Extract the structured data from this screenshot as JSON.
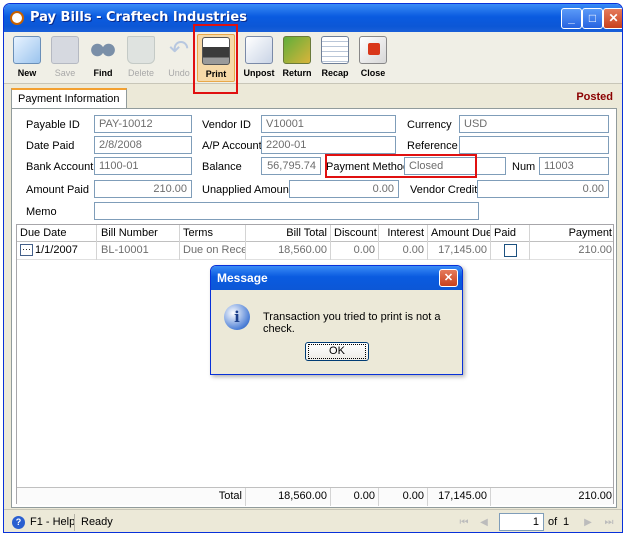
{
  "window": {
    "title": "Pay Bills - Craftech Industries"
  },
  "toolbar": [
    {
      "label": "New",
      "icon": "new-record-icon",
      "enabled": true
    },
    {
      "label": "Save",
      "icon": "save-disk-icon",
      "enabled": false
    },
    {
      "label": "Find",
      "icon": "binoculars-icon",
      "enabled": true
    },
    {
      "label": "Delete",
      "icon": "recycle-bin-icon",
      "enabled": false
    },
    {
      "label": "Undo",
      "icon": "undo-arrow-icon",
      "enabled": false
    },
    {
      "label": "Print",
      "icon": "printer-icon",
      "enabled": true
    },
    {
      "label": "Unpost",
      "icon": "unpost-icon",
      "enabled": true
    },
    {
      "label": "Return",
      "icon": "return-money-icon",
      "enabled": true
    },
    {
      "label": "Recap",
      "icon": "recap-sheet-icon",
      "enabled": true
    },
    {
      "label": "Close",
      "icon": "close-door-icon",
      "enabled": true
    }
  ],
  "tab": {
    "label": "Payment Information"
  },
  "status_badge": "Posted",
  "form": {
    "payable_id": {
      "label": "Payable ID",
      "value": "PAY-10012"
    },
    "vendor_id": {
      "label": "Vendor ID",
      "value": "V10001"
    },
    "currency": {
      "label": "Currency",
      "value": "USD"
    },
    "date_paid": {
      "label": "Date Paid",
      "value": "2/8/2008"
    },
    "ap_account": {
      "label": "A/P Account",
      "value": "2200-01"
    },
    "reference": {
      "label": "Reference",
      "value": ""
    },
    "bank_account": {
      "label": "Bank Account",
      "value": "1100-01"
    },
    "balance": {
      "label": "Balance",
      "value": "56,795.74"
    },
    "payment_method": {
      "label": "Payment Method",
      "value": "Closed"
    },
    "num": {
      "label": "Num",
      "value": "11003"
    },
    "amount_paid": {
      "label": "Amount Paid",
      "value": "210.00"
    },
    "unapplied_amount": {
      "label": "Unapplied Amount",
      "value": "0.00"
    },
    "vendor_credit": {
      "label": "Vendor Credit",
      "value": "0.00"
    },
    "memo": {
      "label": "Memo",
      "value": ""
    }
  },
  "grid": {
    "columns": [
      "Due Date",
      "Bill Number",
      "Terms",
      "Bill Total",
      "Discount",
      "Interest",
      "Amount Due",
      "Paid",
      "Payment"
    ],
    "rows": [
      {
        "due_date": "1/1/2007",
        "bill_number": "BL-10001",
        "terms": "Due on Receip",
        "bill_total": "18,560.00",
        "discount": "0.00",
        "interest": "0.00",
        "amount_due": "17,145.00",
        "paid": false,
        "payment": "210.00"
      }
    ],
    "totals": {
      "label": "Total",
      "bill_total": "18,560.00",
      "discount": "0.00",
      "interest": "0.00",
      "amount_due": "17,145.00",
      "payment": "210.00"
    }
  },
  "status": {
    "help": "F1 - Help",
    "state": "Ready",
    "page": "1",
    "of_label": "of",
    "total_pages": "1"
  },
  "dialog": {
    "title": "Message",
    "message": "Transaction you tried to print is not a check.",
    "ok_label": "OK"
  },
  "colors": {
    "title_bar": "#0a5be0",
    "posted": "#8b0000",
    "highlight": "#e01010"
  }
}
